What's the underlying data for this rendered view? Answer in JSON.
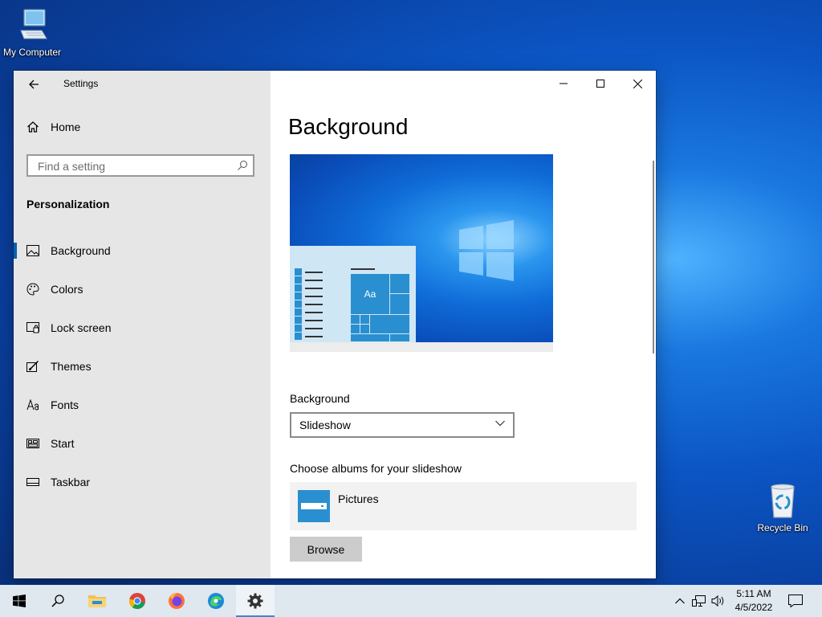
{
  "desktop": {
    "my_computer_label": "My Computer",
    "recycle_bin_label": "Recycle Bin"
  },
  "window": {
    "title": "Settings",
    "controls": [
      "minimize",
      "maximize",
      "close"
    ]
  },
  "sidebar": {
    "home_label": "Home",
    "search_placeholder": "Find a setting",
    "section": "Personalization",
    "items": [
      {
        "label": "Background",
        "icon": "image-icon",
        "active": true
      },
      {
        "label": "Colors",
        "icon": "palette-icon",
        "active": false
      },
      {
        "label": "Lock screen",
        "icon": "lock-screen-icon",
        "active": false
      },
      {
        "label": "Themes",
        "icon": "brush-icon",
        "active": false
      },
      {
        "label": "Fonts",
        "icon": "font-icon",
        "active": false
      },
      {
        "label": "Start",
        "icon": "start-icon",
        "active": false
      },
      {
        "label": "Taskbar",
        "icon": "taskbar-icon",
        "active": false
      }
    ]
  },
  "main": {
    "title": "Background",
    "preview_tile_text": "Aa",
    "background_label": "Background",
    "background_value": "Slideshow",
    "albums_label": "Choose albums for your slideshow",
    "album_name": "Pictures",
    "browse_label": "Browse"
  },
  "taskbar": {
    "apps": [
      "start",
      "search",
      "file-explorer",
      "chrome",
      "firefox",
      "edge",
      "settings"
    ],
    "active_app": "settings",
    "time": "5:11 AM",
    "date": "4/5/2022"
  },
  "colors": {
    "accent": "#0063b1",
    "tile_blue": "#2a8fd0"
  }
}
